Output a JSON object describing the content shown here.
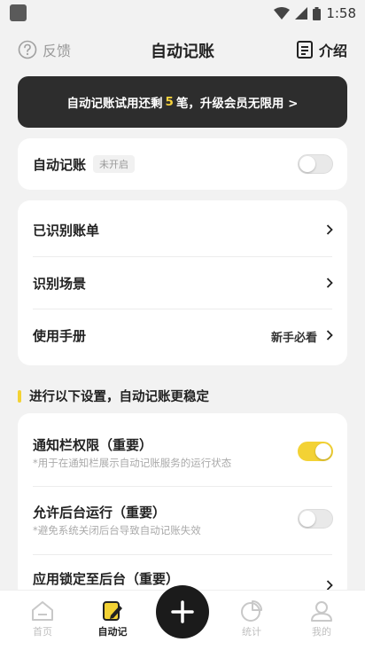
{
  "status": {
    "time": "1:58"
  },
  "header": {
    "feedback_label": "反馈",
    "title": "自动记账",
    "intro_label": "介绍"
  },
  "banner": {
    "text_before": "自动记账试用还剩",
    "remaining": "5",
    "text_after": "笔，升级会员无限用 >"
  },
  "auto_card": {
    "label": "自动记账",
    "badge": "未开启",
    "enabled": false
  },
  "list": {
    "items": [
      {
        "label": "已识别账单"
      },
      {
        "label": "识别场景"
      },
      {
        "label": "使用手册",
        "hint": "新手必看"
      }
    ]
  },
  "section": {
    "title": "进行以下设置，自动记账更稳定"
  },
  "settings": {
    "items": [
      {
        "title": "通知栏权限（重要）",
        "desc": "*用于在通知栏展示自动记账服务的运行状态",
        "enabled": true
      },
      {
        "title": "允许后台运行（重要）",
        "desc": "*避免系统关闭后台导致自动记账失效",
        "enabled": false
      },
      {
        "title": "应用锁定至后台（重要）"
      }
    ]
  },
  "tabs": [
    {
      "label": "首页",
      "icon": "home-icon"
    },
    {
      "label": "自动记",
      "icon": "edit-note-icon"
    },
    {
      "label": "统计",
      "icon": "pie-chart-icon"
    },
    {
      "label": "我的",
      "icon": "person-icon"
    }
  ],
  "fab": {
    "icon": "plus-icon"
  },
  "colors": {
    "accent": "#f3d234",
    "banner_bg": "#2d2d2d",
    "background": "#f2f2f2"
  }
}
